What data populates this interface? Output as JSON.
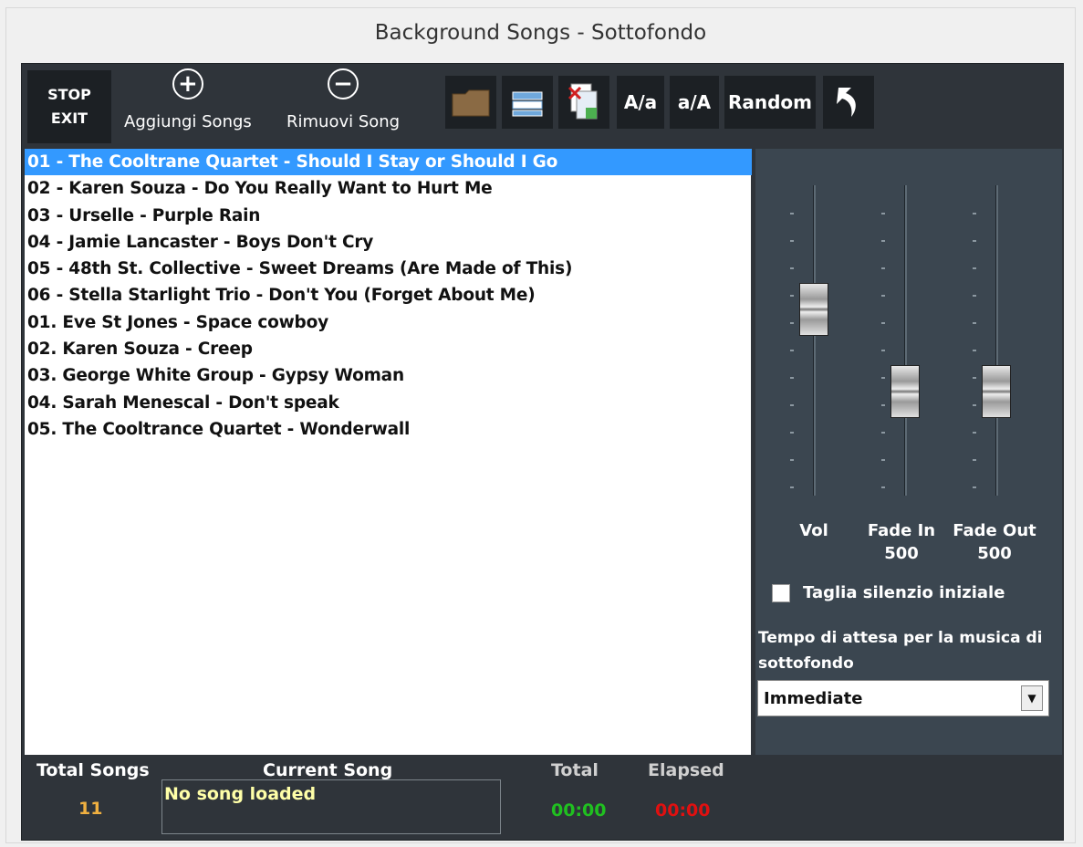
{
  "window": {
    "title": "Background Songs - Sottofondo"
  },
  "toolbar": {
    "stop_line1": "STOP",
    "stop_line2": "EXIT",
    "add_label": "Aggiungi Songs",
    "remove_label": "Rimuovi Song",
    "uppercase_label": "A/a",
    "lowercase_label": "a/A",
    "random_label": "Random"
  },
  "songs": [
    "01 - The Cooltrane Quartet - Should I Stay or Should I Go",
    "02 - Karen Souza - Do You Really Want to Hurt Me",
    "03 - Urselle - Purple Rain",
    "04 - Jamie Lancaster - Boys Don't Cry",
    "05 - 48th St. Collective - Sweet Dreams (Are Made of This)",
    "06 - Stella Starlight Trio - Don't You (Forget About Me)",
    "01. Eve St Jones - Space cowboy",
    "02. Karen Souza - Creep",
    "03. George White Group - Gypsy Woman",
    "04. Sarah Menescal - Don't speak",
    "05. The Cooltrance Quartet - Wonderwall"
  ],
  "selected_song_index": 0,
  "sliders": {
    "vol": {
      "label": "Vol",
      "level": 0.62
    },
    "fade_in": {
      "label": "Fade In",
      "value": "500",
      "level": 0.3
    },
    "fade_out": {
      "label": "Fade Out",
      "value": "500",
      "level": 0.3
    }
  },
  "options": {
    "trim_silence_label": "Taglia silenzio iniziale",
    "trim_silence_checked": false,
    "wait_label": "Tempo di attesa per la musica di sottofondo",
    "wait_value": "Immediate"
  },
  "footer": {
    "total_songs_label": "Total Songs",
    "total_songs_value": "11",
    "current_song_label": "Current Song",
    "current_song_value": "No song loaded",
    "total_label": "Total",
    "total_value": "00:00",
    "elapsed_label": "Elapsed",
    "elapsed_value": "00:00"
  },
  "colors": {
    "selection": "#3399ff",
    "total_time": "#20c020",
    "elapsed_time": "#e01010",
    "song_count": "#f0b040"
  }
}
